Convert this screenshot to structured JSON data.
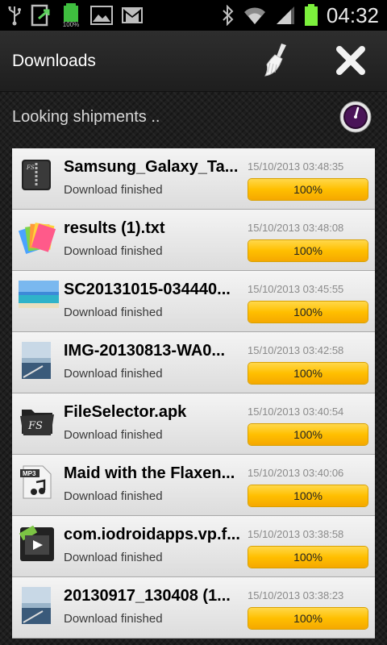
{
  "status_bar": {
    "time": "04:32",
    "battery_small_label": "100%",
    "left_icons": [
      "usb-icon",
      "file-transfer-icon",
      "battery-full-icon",
      "image-icon",
      "gmail-icon"
    ],
    "right_icons": [
      "bluetooth-icon",
      "wifi-icon",
      "signal-icon",
      "battery-icon"
    ]
  },
  "action_bar": {
    "title": "Downloads",
    "actions": [
      "broom-icon",
      "close-icon"
    ]
  },
  "status_text": "Looking shipments ..",
  "colors": {
    "progress_fill": "#ffbf00",
    "row_bg": "#e6e6e6",
    "accent": "#ffc800"
  },
  "downloads": [
    {
      "name": "Samsung_Galaxy_Ta...",
      "status": "Download finished",
      "date": "15/10/2013 03:48:35",
      "progress_label": "100%",
      "progress": 1.0,
      "thumb": "zip-file-icon"
    },
    {
      "name": "results (1).txt",
      "status": "Download finished",
      "date": "15/10/2013 03:48:08",
      "progress_label": "100%",
      "progress": 1.0,
      "thumb": "text-document-icon"
    },
    {
      "name": "SC20131015-034440...",
      "status": "Download finished",
      "date": "15/10/2013 03:45:55",
      "progress_label": "100%",
      "progress": 1.0,
      "thumb": "image-thumbnail-icon"
    },
    {
      "name": "IMG-20130813-WA0...",
      "status": "Download finished",
      "date": "15/10/2013 03:42:58",
      "progress_label": "100%",
      "progress": 1.0,
      "thumb": "photo-thumbnail-icon"
    },
    {
      "name": "FileSelector.apk",
      "status": "Download finished",
      "date": "15/10/2013 03:40:54",
      "progress_label": "100%",
      "progress": 1.0,
      "thumb": "apk-folder-icon"
    },
    {
      "name": "Maid with the Flaxen...",
      "status": "Download finished",
      "date": "15/10/2013 03:40:06",
      "progress_label": "100%",
      "progress": 1.0,
      "thumb": "mp3-file-icon"
    },
    {
      "name": "com.iodroidapps.vp.f...",
      "status": "Download finished",
      "date": "15/10/2013 03:38:58",
      "progress_label": "100%",
      "progress": 1.0,
      "thumb": "video-file-icon"
    },
    {
      "name": "20130917_130408 (1...",
      "status": "Download finished",
      "date": "15/10/2013 03:38:23",
      "progress_label": "100%",
      "progress": 1.0,
      "thumb": "photo-thumbnail-icon"
    }
  ]
}
